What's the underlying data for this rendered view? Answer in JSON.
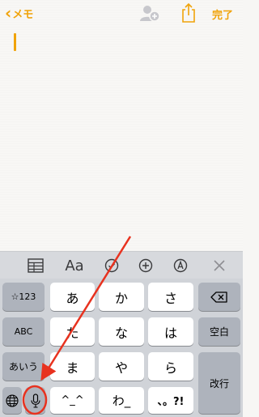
{
  "nav": {
    "back_label": "メモ",
    "done_label": "完了"
  },
  "toolbar": {
    "items": [
      "table-icon",
      "Aa",
      "checklist-icon",
      "plus-icon",
      "compose-icon",
      "close-icon"
    ],
    "format_label": "Aa"
  },
  "keyboard": {
    "row1": {
      "mode_key": "☆123",
      "keys": [
        "あ",
        "か",
        "さ"
      ],
      "delete": "delete-icon"
    },
    "row2": {
      "mode_key": "ABC",
      "keys": [
        "た",
        "な",
        "は"
      ],
      "space": "空白"
    },
    "row3": {
      "mode_key": "あいう",
      "keys": [
        "ま",
        "や",
        "ら"
      ],
      "return": "改行"
    },
    "row4": {
      "globe": "globe-icon",
      "mic": "mic-icon",
      "keys": [
        "^_^",
        "わ_",
        "、。?!"
      ]
    }
  },
  "colors": {
    "accent": "#f0a30a",
    "annotation": "#e8321f"
  }
}
